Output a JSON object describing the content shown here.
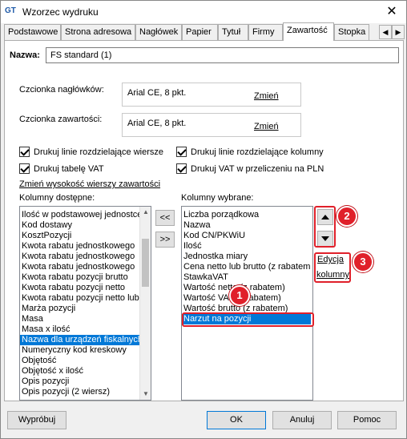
{
  "window": {
    "title": "Wzorzec wydruku",
    "app_icon": "GT",
    "close_glyph": "✕"
  },
  "tabs": [
    {
      "label": "Podstawowe"
    },
    {
      "label": "Strona adresowa"
    },
    {
      "label": "Nagłówek"
    },
    {
      "label": "Papier"
    },
    {
      "label": "Tytuł"
    },
    {
      "label": "Firmy"
    },
    {
      "label": "Zawartość"
    },
    {
      "label": "Stopka"
    }
  ],
  "active_tab": "Zawartość",
  "name_field": {
    "label": "Nazwa:",
    "value": "FS standard (1)"
  },
  "fonts": {
    "header": {
      "label": "Czcionka nagłówków:",
      "value": "Arial CE, 8 pkt.",
      "change": "Zmień"
    },
    "content": {
      "label": "Czcionka zawartości:",
      "value": "Arial CE, 8 pkt.",
      "change": "Zmień"
    }
  },
  "checkboxes": {
    "row_lines": "Drukuj linie rozdzielające wiersze",
    "col_lines": "Drukuj linie rozdzielające kolumny",
    "vat_table": "Drukuj tabelę VAT",
    "vat_pln": "Drukuj VAT w przeliczeniu na PLN"
  },
  "row_height_link": "Zmień wysokość wierszy zawartości",
  "available": {
    "label": "Kolumny dostępne:",
    "items": [
      "Ilość w podstawowej jednostce",
      "Kod dostawy",
      "KosztPozycji",
      "Kwota rabatu jednostkowego",
      "Kwota rabatu jednostkowego",
      "Kwota rabatu jednostkowego",
      "Kwota rabatu pozycji brutto",
      "Kwota rabatu pozycji netto",
      "Kwota rabatu pozycji netto lub",
      "Marża pozycji",
      "Masa",
      "Masa x ilość",
      "Nazwa dla urządzeń fiskalnych",
      "Numeryczny kod kreskowy",
      "Objętość",
      "Objętość x ilość",
      "Opis pozycji",
      "Opis pozycji (2 wiersz)"
    ],
    "selected_index": 12
  },
  "move_buttons": {
    "remove": "<<",
    "add": ">>"
  },
  "selected": {
    "label": "Kolumny wybrane:",
    "items": [
      "Liczba porządkowa",
      "Nazwa",
      "Kod CN/PKWiU",
      "Ilość",
      "Jednostka miary",
      "Cena netto lub brutto (z rabatem",
      "StawkaVAT",
      "Wartość netto (z rabatem)",
      "Wartość VAT (z rabatem)",
      "Wartość brutto (z rabatem)",
      "Narzut na pozycji"
    ],
    "selected_index": 10
  },
  "column_edit": {
    "line1": "Edycja",
    "line2": "kolumny"
  },
  "badges": {
    "b1": "1",
    "b2": "2",
    "b3": "3"
  },
  "footer": {
    "preview": "Wypróbuj",
    "ok": "OK",
    "cancel": "Anuluj",
    "help": "Pomoc"
  },
  "colors": {
    "highlight": "#e0202a",
    "selection": "#0078d7"
  }
}
